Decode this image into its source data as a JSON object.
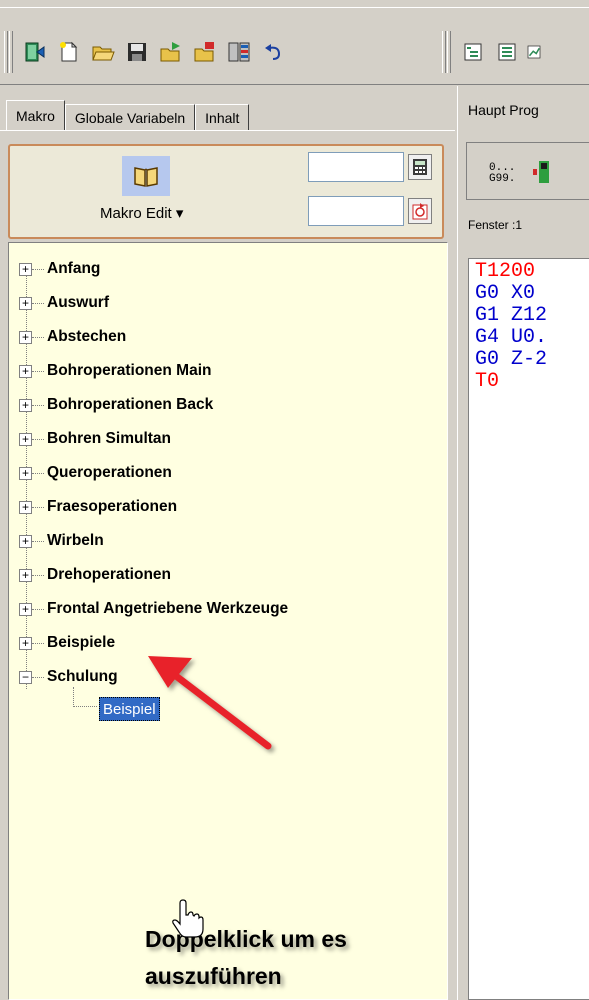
{
  "toolbar": {
    "group1_icons": [
      "exit-icon",
      "new-file-icon",
      "open-folder-icon",
      "save-disk-icon",
      "import-icon",
      "export-icon",
      "split-view-icon",
      "undo-icon"
    ],
    "group2_icons": [
      "tree-view-icon",
      "list-view-icon",
      "chart-icon"
    ]
  },
  "tabs": [
    {
      "label": "Makro",
      "active": true
    },
    {
      "label": "Globale Variabeln",
      "active": false
    },
    {
      "label": "Inhalt",
      "active": false
    }
  ],
  "macro": {
    "edit_label": "Makro Edit ▾",
    "icon": "book-icon",
    "field1_value": "",
    "field2_value": ""
  },
  "tree": {
    "items": [
      {
        "label": "Anfang",
        "expanded": false
      },
      {
        "label": "Auswurf",
        "expanded": false
      },
      {
        "label": "Abstechen",
        "expanded": false
      },
      {
        "label": "Bohroperationen Main",
        "expanded": false
      },
      {
        "label": "Bohroperationen Back",
        "expanded": false
      },
      {
        "label": "Bohren Simultan",
        "expanded": false
      },
      {
        "label": "Queroperationen",
        "expanded": false
      },
      {
        "label": "Fraesoperationen",
        "expanded": false
      },
      {
        "label": "Wirbeln",
        "expanded": false
      },
      {
        "label": "Drehoperationen",
        "expanded": false
      },
      {
        "label": "Frontal Angetriebene Werkzeuge",
        "expanded": false
      },
      {
        "label": "Beispiele",
        "expanded": false
      },
      {
        "label": "Schulung",
        "expanded": true
      }
    ],
    "child": {
      "label": "Beispiel",
      "selected": true
    }
  },
  "annotation": {
    "line1": "Doppelklick um es",
    "line2": "auszuführen"
  },
  "right": {
    "tab_label": "Haupt Prog",
    "toolbar_label_1": "0...",
    "toolbar_label_2": "G99.",
    "window_label": "Fenster :1",
    "code": [
      {
        "text": "T1200",
        "color": "#ff0000"
      },
      {
        "text": "G0 X0",
        "color": "#0000cc"
      },
      {
        "text": "G1 Z12",
        "color": "#0000cc"
      },
      {
        "text": "G4 U0.",
        "color": "#0000cc"
      },
      {
        "text": "G0 Z-2",
        "color": "#0000cc"
      },
      {
        "text": "T0",
        "color": "#ff0000"
      }
    ]
  },
  "colors": {
    "tree_bg": "#ffffe1",
    "selection": "#316ac5",
    "macro_border": "#c98a5a",
    "arrow": "#e8242a"
  }
}
